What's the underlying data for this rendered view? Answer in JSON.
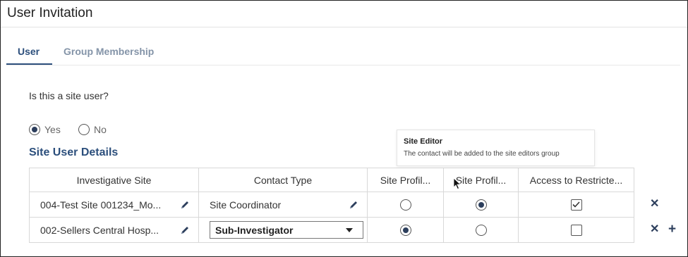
{
  "header": {
    "title": "User Invitation"
  },
  "tabs": [
    {
      "label": "User",
      "active": true
    },
    {
      "label": "Group Membership",
      "active": false
    }
  ],
  "form": {
    "question": "Is this a site user?",
    "options": [
      {
        "label": "Yes",
        "selected": true
      },
      {
        "label": "No",
        "selected": false
      }
    ]
  },
  "section": {
    "title": "Site User Details"
  },
  "tooltip": {
    "title": "Site Editor",
    "body": "The contact will be added to the site editors group"
  },
  "table": {
    "headers": [
      "Investigative Site",
      "Contact Type",
      "Site Profil...",
      "Site Profil...",
      "Access to Restricte..."
    ],
    "rows": [
      {
        "site": "004-Test Site 001234_Mo...",
        "contact_type": "Site Coordinator",
        "profile1_selected": false,
        "profile2_selected": true,
        "restricted_checked": true
      },
      {
        "site": "002-Sellers Central Hosp...",
        "contact_type": "Sub-Investigator",
        "profile1_selected": true,
        "profile2_selected": false,
        "restricted_checked": false
      }
    ]
  },
  "colors": {
    "accent": "#2c4f7c",
    "tab_inactive": "#8494a8",
    "border": "#d8d8d8",
    "icon": "#2c3e5c"
  },
  "icons": {
    "edit": "pencil-icon",
    "remove": "close-icon",
    "add": "plus-icon",
    "dropdown": "caret-down-icon"
  }
}
